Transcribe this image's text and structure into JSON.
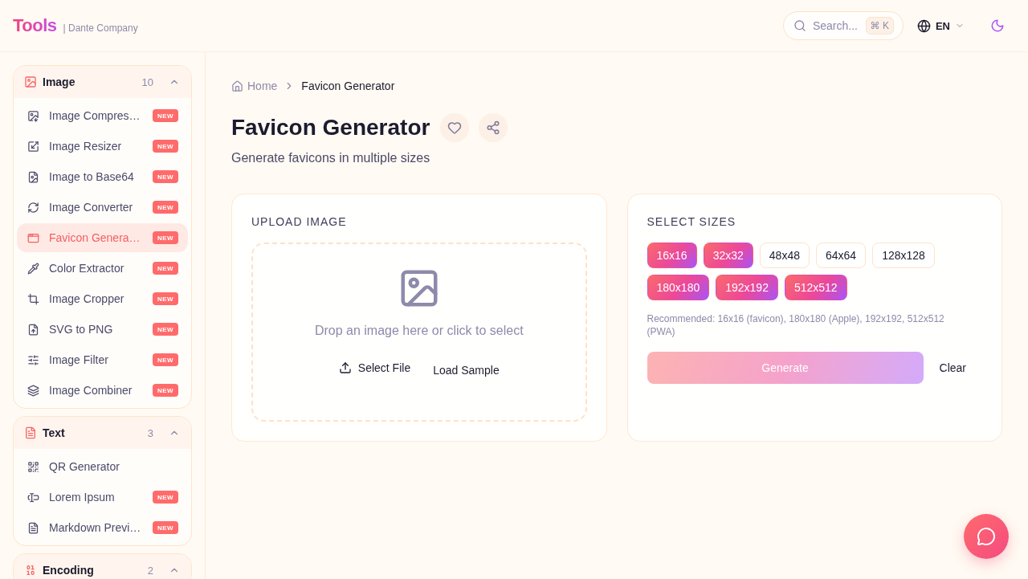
{
  "header": {
    "logo": "Tools",
    "company": "| Dante Company",
    "search": {
      "placeholder": "Search...",
      "shortcut": "⌘ K"
    },
    "language": "EN"
  },
  "sidebar": {
    "groups": [
      {
        "title": "Image",
        "count": "10",
        "expanded": true,
        "items": [
          {
            "label": "Image Compres…",
            "badge": "NEW",
            "selected": false
          },
          {
            "label": "Image Resizer",
            "badge": "NEW",
            "selected": false
          },
          {
            "label": "Image to Base64",
            "badge": "NEW",
            "selected": false
          },
          {
            "label": "Image Converter",
            "badge": "NEW",
            "selected": false
          },
          {
            "label": "Favicon Genera…",
            "badge": "NEW",
            "selected": true
          },
          {
            "label": "Color Extractor",
            "badge": "NEW",
            "selected": false
          },
          {
            "label": "Image Cropper",
            "badge": "NEW",
            "selected": false
          },
          {
            "label": "SVG to PNG",
            "badge": "NEW",
            "selected": false
          },
          {
            "label": "Image Filter",
            "badge": "NEW",
            "selected": false
          },
          {
            "label": "Image Combiner",
            "badge": "NEW",
            "selected": false
          }
        ]
      },
      {
        "title": "Text",
        "count": "3",
        "expanded": true,
        "items": [
          {
            "label": "QR Generator",
            "selected": false
          },
          {
            "label": "Lorem Ipsum",
            "badge": "NEW",
            "selected": false
          },
          {
            "label": "Markdown Previ…",
            "badge": "NEW",
            "selected": false
          }
        ]
      },
      {
        "title": "Encoding",
        "count": "2",
        "expanded": true
      }
    ]
  },
  "breadcrumb": [
    {
      "label": "Home"
    },
    {
      "label": "Favicon Generator"
    }
  ],
  "page": {
    "title": "Favicon Generator",
    "subtitle": "Generate favicons in multiple sizes"
  },
  "upload": {
    "heading": "UPLOAD IMAGE",
    "prompt": "Drop an image here or click to select",
    "select_button": "Select File",
    "sample_button": "Load Sample"
  },
  "sizes": {
    "heading": "SELECT SIZES",
    "options": [
      {
        "label": "16x16",
        "selected": true
      },
      {
        "label": "32x32",
        "selected": true
      },
      {
        "label": "48x48",
        "selected": false
      },
      {
        "label": "64x64",
        "selected": false
      },
      {
        "label": "128x128",
        "selected": false
      },
      {
        "label": "180x180",
        "selected": true
      },
      {
        "label": "192x192",
        "selected": true
      },
      {
        "label": "512x512",
        "selected": true
      }
    ],
    "note": "Recommended: 16x16 (favicon), 180x180 (Apple), 192x192, 512x512 (PWA)",
    "generate": {
      "label": "Generate",
      "disabled": true
    },
    "clear": "Clear"
  }
}
